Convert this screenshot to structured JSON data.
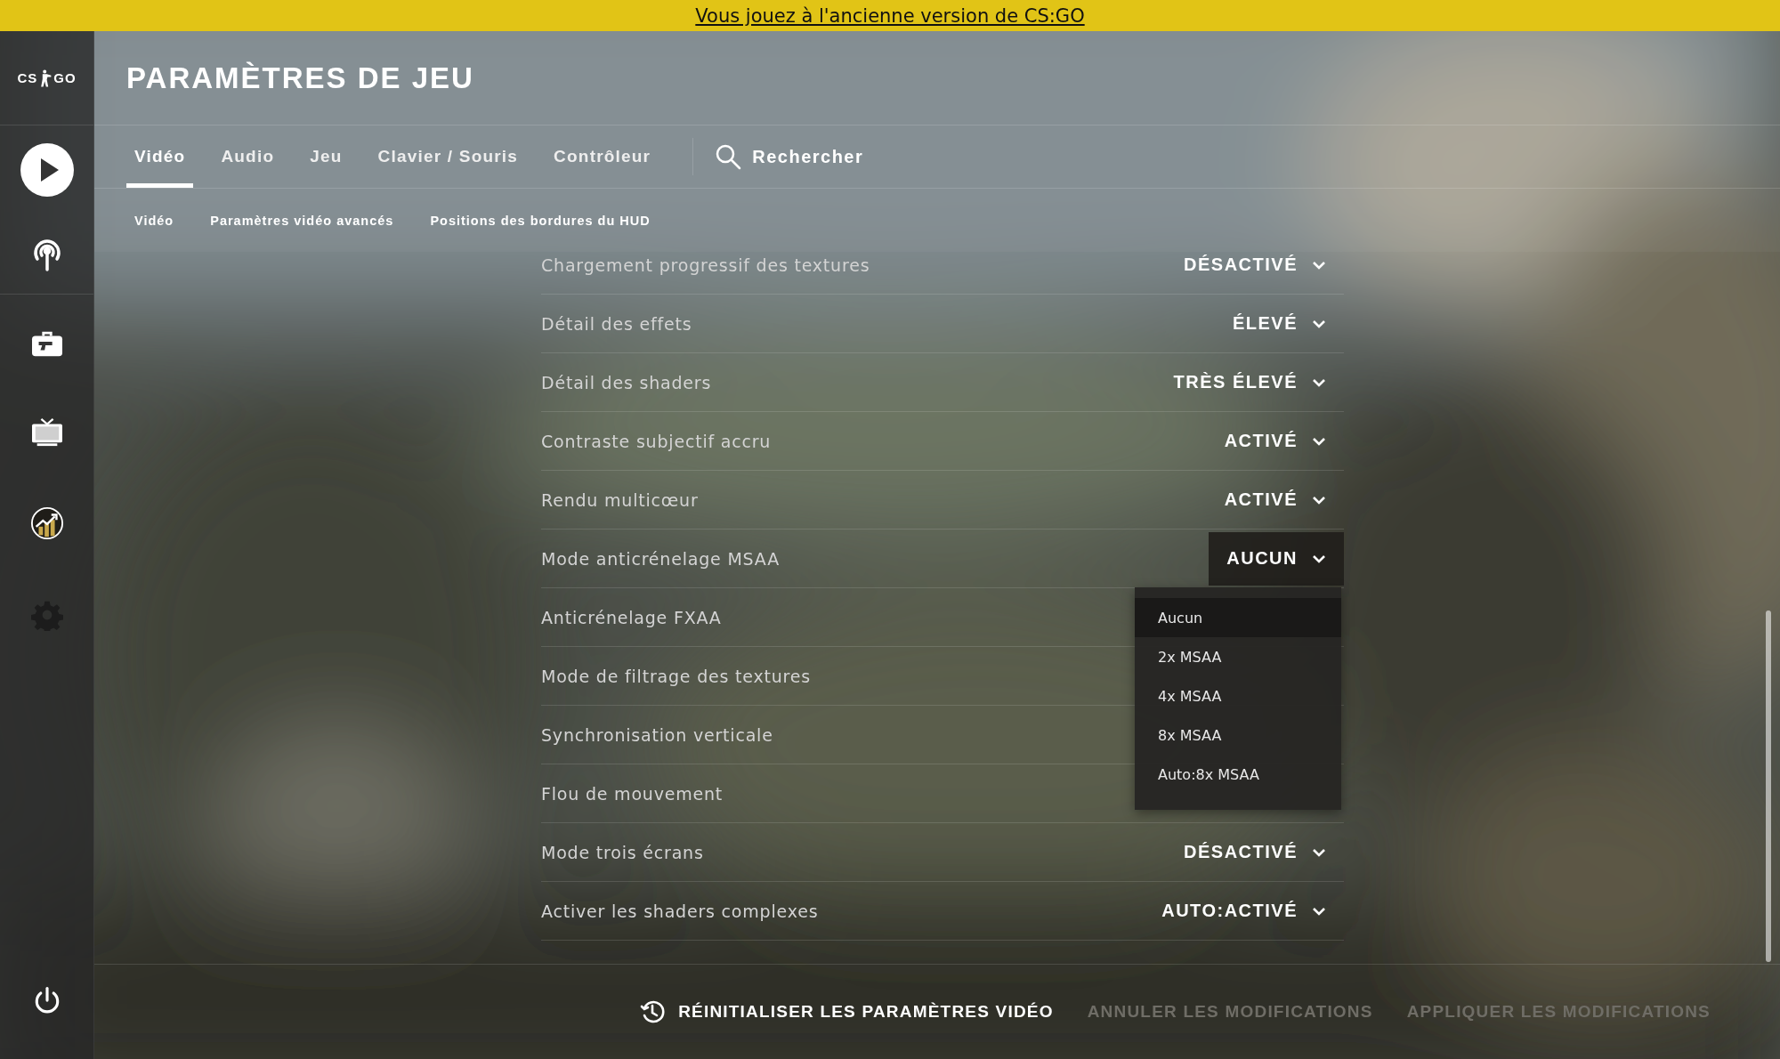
{
  "banner": {
    "text": "Vous jouez à l'ancienne version de CS:GO"
  },
  "logo": {
    "left": "CS",
    "right": "GO"
  },
  "header": {
    "title": "PARAMÈTRES DE JEU"
  },
  "tabs": [
    {
      "label": "Vidéo",
      "selected": true
    },
    {
      "label": "Audio",
      "selected": false
    },
    {
      "label": "Jeu",
      "selected": false
    },
    {
      "label": "Clavier / Souris",
      "selected": false
    },
    {
      "label": "Contrôleur",
      "selected": false
    }
  ],
  "search": {
    "label": "Rechercher"
  },
  "subtabs": [
    "Vidéo",
    "Paramètres vidéo avancés",
    "Positions des bordures du HUD"
  ],
  "settings": [
    {
      "label": "Chargement progressif des textures",
      "value": "DÉSACTIVÉ",
      "open": false
    },
    {
      "label": "Détail des effets",
      "value": "ÉLEVÉ",
      "open": false
    },
    {
      "label": "Détail des shaders",
      "value": "TRÈS ÉLEVÉ",
      "open": false
    },
    {
      "label": "Contraste subjectif accru",
      "value": "ACTIVÉ",
      "open": false
    },
    {
      "label": "Rendu multicœur",
      "value": "ACTIVÉ",
      "open": false
    },
    {
      "label": "Mode anticrénelage MSAA",
      "value": "AUCUN",
      "open": true
    },
    {
      "label": "Anticrénelage FXAA"
    },
    {
      "label": "Mode de filtrage des textures"
    },
    {
      "label": "Synchronisation verticale"
    },
    {
      "label": "Flou de mouvement"
    },
    {
      "label": "Mode trois écrans",
      "value": "DÉSACTIVÉ",
      "open": false
    },
    {
      "label": "Activer les shaders complexes",
      "value": "AUTO:ACTIVÉ",
      "open": false
    }
  ],
  "dropdown": {
    "options": [
      {
        "label": "Aucun",
        "selected": true
      },
      {
        "label": "2x MSAA",
        "selected": false
      },
      {
        "label": "4x MSAA",
        "selected": false
      },
      {
        "label": "8x MSAA",
        "selected": false
      },
      {
        "label": "Auto:8x MSAA",
        "selected": false
      }
    ]
  },
  "footer": {
    "actions": [
      {
        "label": "RÉINITIALISER LES PARAMÈTRES VIDÉO",
        "kind": "reset",
        "disabled": false
      },
      {
        "label": "ANNULER LES MODIFICATIONS",
        "kind": "plain",
        "disabled": true
      },
      {
        "label": "APPLIQUER LES MODIFICATIONS",
        "kind": "plain",
        "disabled": true
      }
    ]
  }
}
